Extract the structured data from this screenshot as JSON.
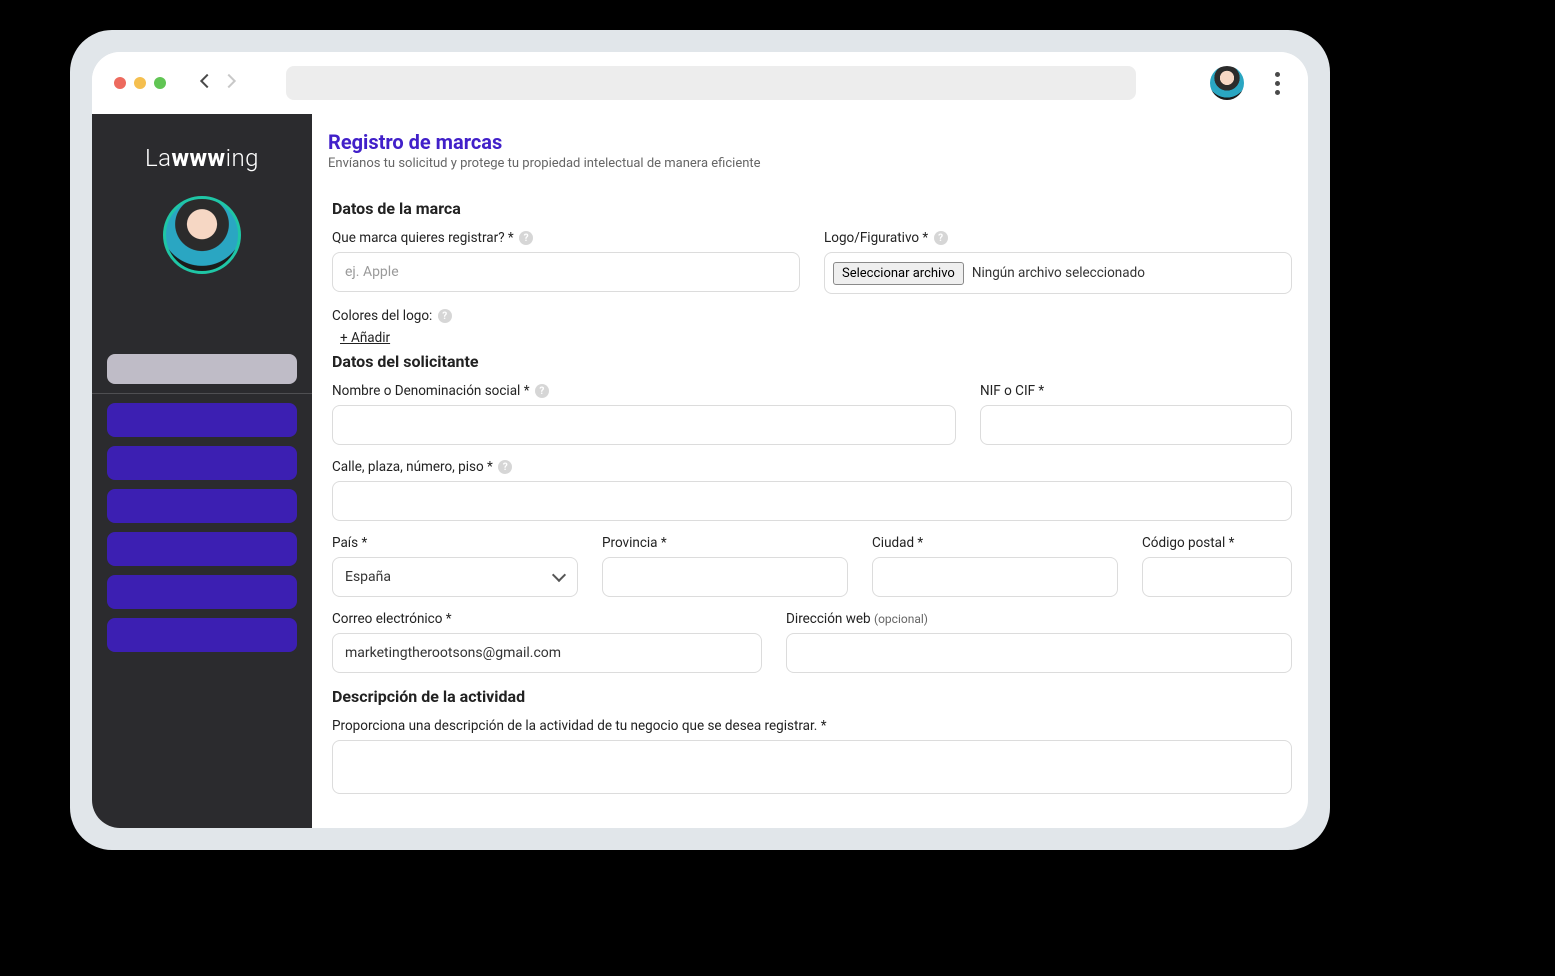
{
  "brand": "Lawwwing",
  "page": {
    "title": "Registro de marcas",
    "subtitle": "Envíanos tu solicitud y protege tu propiedad intelectual de manera eficiente"
  },
  "sections": {
    "brand_data": {
      "title": "Datos de la marca",
      "q_brand_label": "Que marca quieres registrar? *",
      "q_brand_placeholder": "ej. Apple",
      "logo_label": "Logo/Figurativo *",
      "file_button": "Seleccionar archivo",
      "file_status": "Ningún archivo seleccionado",
      "colors_label": "Colores del logo:",
      "add_label": "+ Añadir"
    },
    "applicant": {
      "title": "Datos del solicitante",
      "name_label": "Nombre o Denominación social *",
      "nif_label": "NIF o CIF *",
      "address_label": "Calle, plaza, número, piso *",
      "country_label": "País *",
      "country_value": "España",
      "province_label": "Provincia *",
      "city_label": "Ciudad *",
      "postal_label": "Código postal *",
      "email_label": "Correo electrónico *",
      "email_value": "marketingtherootsons@gmail.com",
      "web_label": "Dirección web",
      "web_optional": "(opcional)"
    },
    "activity": {
      "title": "Descripción de la actividad",
      "desc_label": "Proporciona una descripción de la actividad de tu negocio que se desea registrar. *"
    }
  }
}
